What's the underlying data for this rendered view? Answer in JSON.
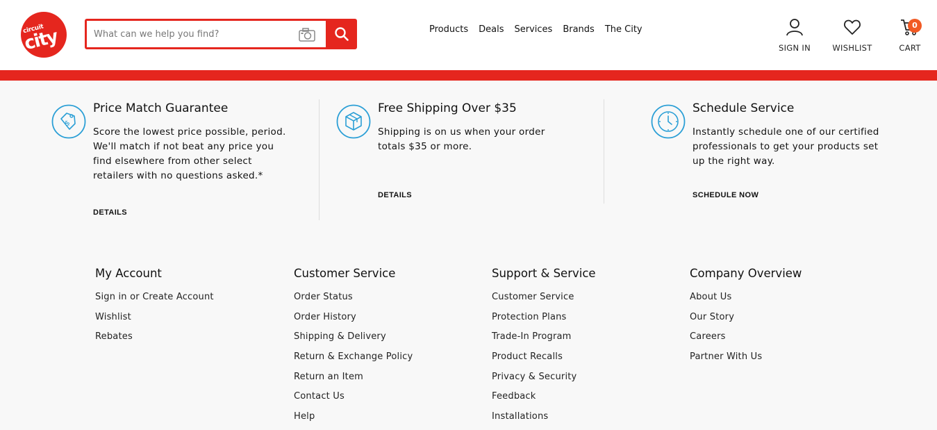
{
  "header": {
    "logo_line1": "circuit",
    "logo_line2": "city",
    "search_placeholder": "What can we help you find?",
    "nav": [
      "Products",
      "Deals",
      "Services",
      "Brands",
      "The City"
    ],
    "sign_in": "SIGN IN",
    "wishlist": "WISHLIST",
    "cart": "CART",
    "cart_count": "0"
  },
  "colors": {
    "brand_red": "#e5261e",
    "badge_orange": "#f15a24",
    "icon_blue": "#2b9fd6"
  },
  "promos": [
    {
      "icon": "price-tag-icon",
      "title": "Price Match Guarantee",
      "text": "Score the lowest price possible, period. We'll match if not beat any price you find elsewhere from other select retailers with no questions asked.*",
      "link": "DETAILS"
    },
    {
      "icon": "box-icon",
      "title": "Free Shipping Over $35",
      "text": "Shipping is on us when your order totals $35 or more.",
      "link": "DETAILS"
    },
    {
      "icon": "clock-icon",
      "title": "Schedule Service",
      "text": "Instantly schedule one of our certified professionals to get your products set up the right way.",
      "link": "SCHEDULE NOW"
    }
  ],
  "footer": [
    {
      "heading": "My Account",
      "links": [
        "Sign in or Create Account",
        "Wishlist",
        "Rebates"
      ]
    },
    {
      "heading": "Customer Service",
      "links": [
        "Order Status",
        "Order History",
        "Shipping & Delivery",
        "Return & Exchange Policy",
        "Return an Item",
        "Contact Us",
        "Help"
      ]
    },
    {
      "heading": "Support & Service",
      "links": [
        "Customer Service",
        "Protection Plans",
        "Trade-In Program",
        "Product Recalls",
        "Privacy & Security",
        "Feedback",
        "Installations"
      ]
    },
    {
      "heading": "Company Overview",
      "links": [
        "About Us",
        "Our Story",
        "Careers",
        "Partner With Us"
      ]
    }
  ]
}
